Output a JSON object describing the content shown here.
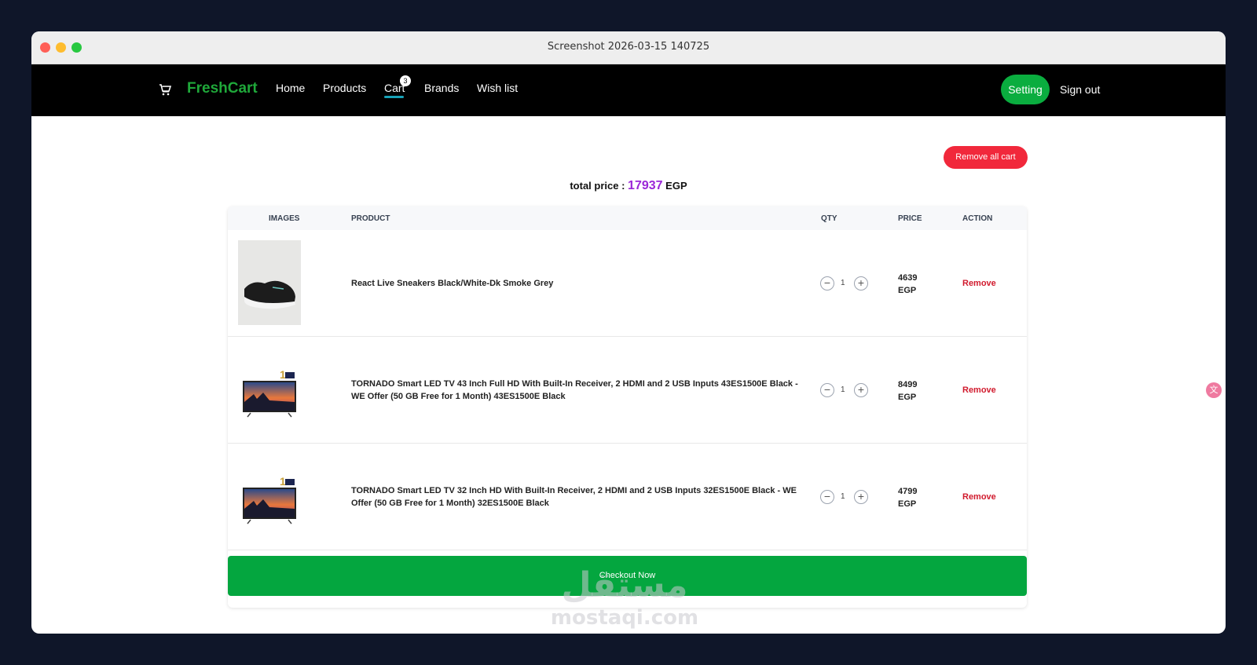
{
  "window": {
    "title": "Screenshot 2026-03-15 140725"
  },
  "navbar": {
    "brand": "FreshCart",
    "links": [
      "Home",
      "Products",
      "Cart",
      "Brands",
      "Wish list"
    ],
    "cart_badge": "3",
    "setting_label": "Setting",
    "signout_label": "Sign out",
    "active_link": "Cart",
    "brand_color": "#1fa83a",
    "active_underline_color": "#17a2b8"
  },
  "cart": {
    "remove_all_label": "Remove all cart",
    "total_label": "total price :",
    "total_value": "17937",
    "total_currency": "EGP",
    "headers": {
      "images": "IMAGES",
      "product": "PRODUCT",
      "qty": "QTY",
      "price": "PRICE",
      "action": "ACTION"
    },
    "items": [
      {
        "name": "React Live Sneakers Black/White-Dk Smoke Grey",
        "qty": "1",
        "price": "4639",
        "currency": "EGP",
        "action": "Remove",
        "image_icon": "sneaker-photo"
      },
      {
        "name": "TORNADO Smart LED TV 43 Inch Full HD With Built-In Receiver, 2 HDMI and 2 USB Inputs 43ES1500E Black - WE Offer (50 GB Free for 1 Month) 43ES1500E Black",
        "qty": "1",
        "price": "8499",
        "currency": "EGP",
        "action": "Remove",
        "image_icon": "tv-photo"
      },
      {
        "name": "TORNADO Smart LED TV 32 Inch HD With Built-In Receiver, 2 HDMI and 2 USB Inputs 32ES1500E Black - WE Offer (50 GB Free for 1 Month) 32ES1500E Black",
        "qty": "1",
        "price": "4799",
        "currency": "EGP",
        "action": "Remove",
        "image_icon": "tv-photo"
      }
    ],
    "checkout_label": "Checkout Now",
    "accent_remove": "#d11b2e",
    "accent_checkout": "#04a63f",
    "accent_total": "#9b27d8"
  },
  "watermark": {
    "arabic": "مستقل",
    "latin": "mostaqi.com"
  }
}
